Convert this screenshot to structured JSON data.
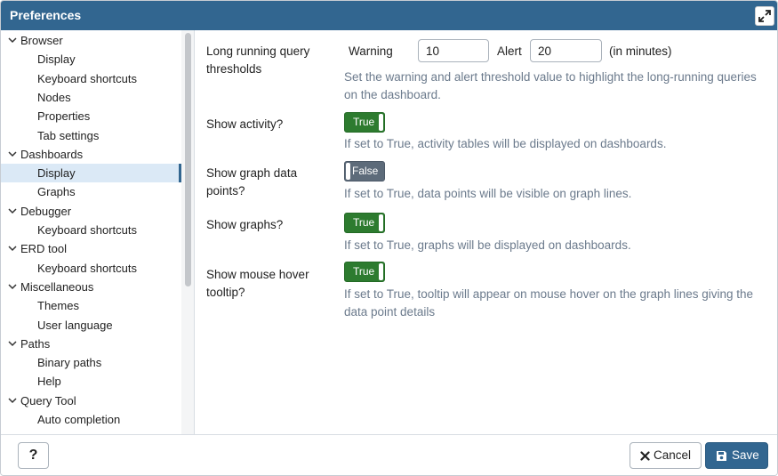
{
  "window": {
    "title": "Preferences"
  },
  "sidebar": {
    "items": [
      {
        "label": "Browser",
        "type": "parent"
      },
      {
        "label": "Display",
        "type": "child"
      },
      {
        "label": "Keyboard shortcuts",
        "type": "child"
      },
      {
        "label": "Nodes",
        "type": "child"
      },
      {
        "label": "Properties",
        "type": "child"
      },
      {
        "label": "Tab settings",
        "type": "child"
      },
      {
        "label": "Dashboards",
        "type": "parent"
      },
      {
        "label": "Display",
        "type": "child",
        "selected": true
      },
      {
        "label": "Graphs",
        "type": "child"
      },
      {
        "label": "Debugger",
        "type": "parent"
      },
      {
        "label": "Keyboard shortcuts",
        "type": "child"
      },
      {
        "label": "ERD tool",
        "type": "parent"
      },
      {
        "label": "Keyboard shortcuts",
        "type": "child"
      },
      {
        "label": "Miscellaneous",
        "type": "parent"
      },
      {
        "label": "Themes",
        "type": "child"
      },
      {
        "label": "User language",
        "type": "child"
      },
      {
        "label": "Paths",
        "type": "parent"
      },
      {
        "label": "Binary paths",
        "type": "child"
      },
      {
        "label": "Help",
        "type": "child"
      },
      {
        "label": "Query Tool",
        "type": "parent"
      },
      {
        "label": "Auto completion",
        "type": "child"
      }
    ]
  },
  "settings": {
    "long_running": {
      "label": "Long running query thresholds",
      "warning_label": "Warning",
      "warning_value": "10",
      "alert_label": "Alert",
      "alert_value": "20",
      "unit": "(in minutes)",
      "help": "Set the warning and alert threshold value to highlight the long-running queries on the dashboard."
    },
    "show_activity": {
      "label": "Show activity?",
      "value": "True",
      "help": "If set to True, activity tables will be displayed on dashboards."
    },
    "show_graph_points": {
      "label": "Show graph data points?",
      "value": "False",
      "help": "If set to True, data points will be visible on graph lines."
    },
    "show_graphs": {
      "label": "Show graphs?",
      "value": "True",
      "help": "If set to True, graphs will be displayed on dashboards."
    },
    "show_tooltip": {
      "label": "Show mouse hover tooltip?",
      "value": "True",
      "help": "If set to True, tooltip will appear on mouse hover on the graph lines giving the data point details"
    }
  },
  "footer": {
    "help_label": "?",
    "cancel_label": "Cancel",
    "save_label": "Save"
  },
  "colors": {
    "titlebar": "#326690",
    "toggle_on": "#2d7b2f",
    "toggle_off": "#5d6b7a",
    "help_text": "#6b7a8c",
    "selected_row": "#dbe9f6"
  },
  "icons": {
    "maximize": "expand-arrows-icon",
    "tree_parent": "chevron-down-icon",
    "cancel": "close-icon",
    "save": "floppy-disk-icon"
  }
}
